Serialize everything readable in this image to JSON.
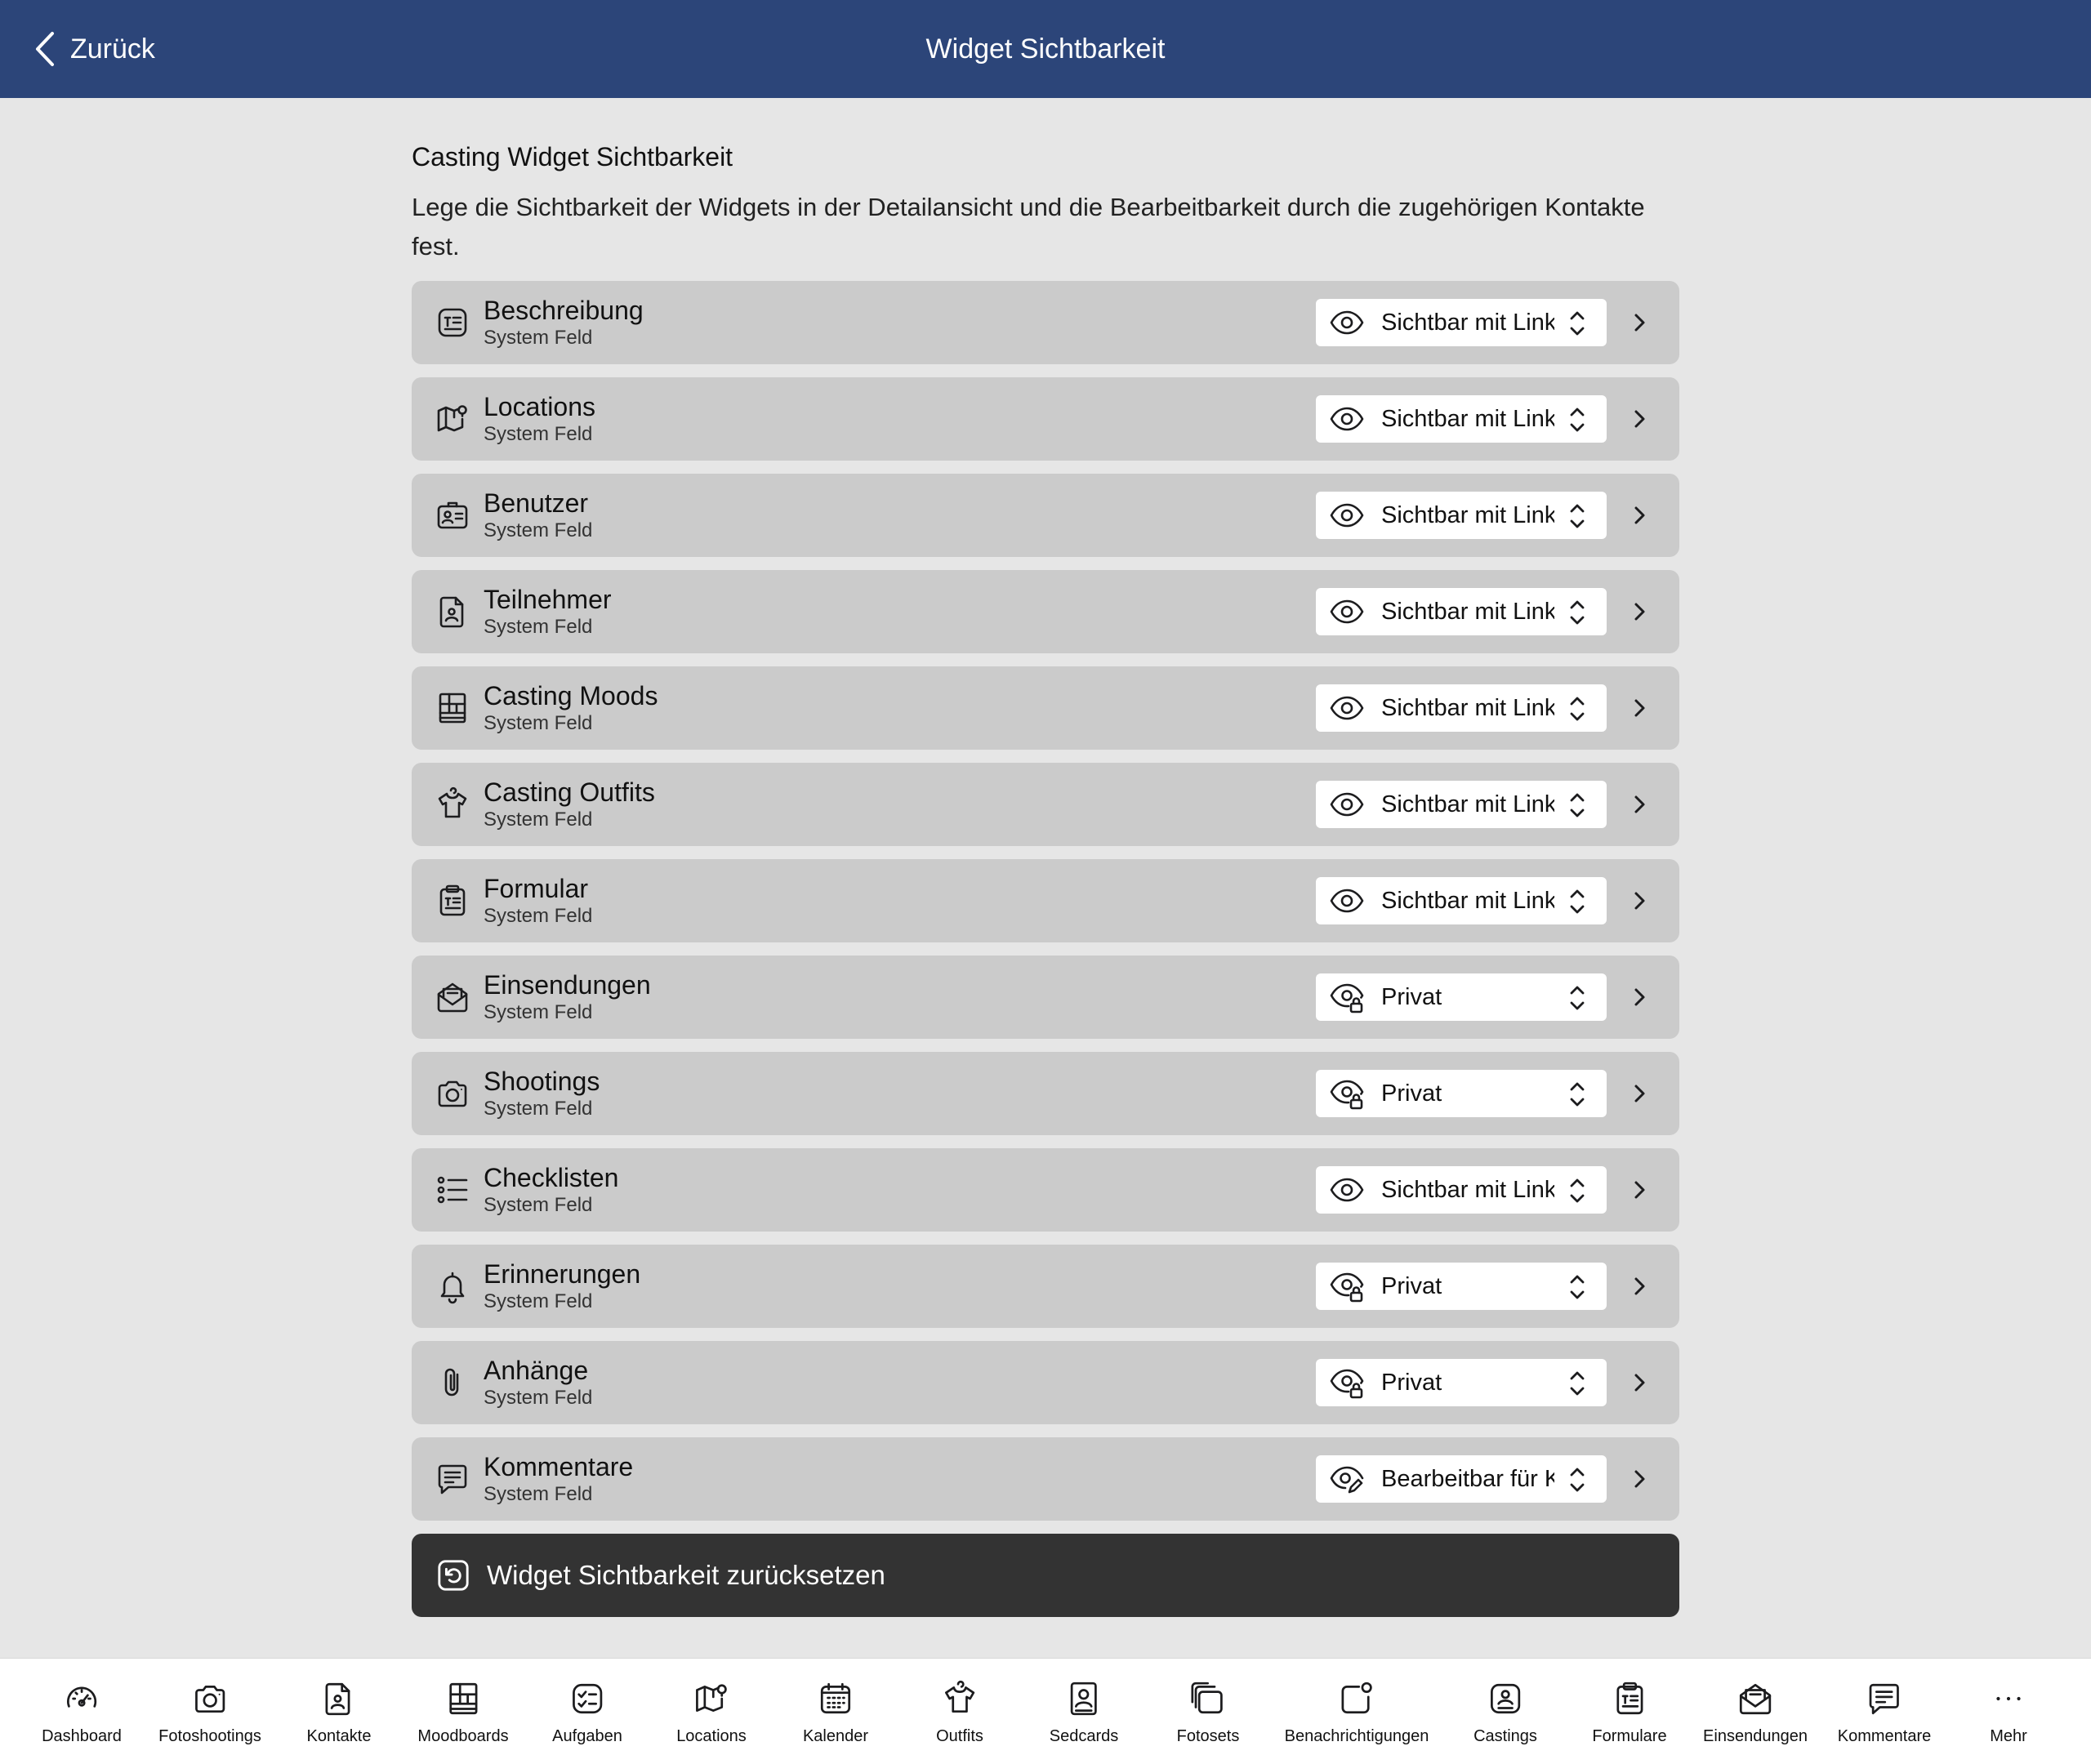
{
  "header": {
    "back_label": "Zurück",
    "title": "Widget Sichtbarkeit"
  },
  "intro": {
    "title": "Casting Widget Sichtbarkeit",
    "description": "Lege die Sichtbarkeit der Widgets in der Detailansicht und die Bearbeitbarkeit durch die zugehörigen Kontakte fest."
  },
  "widgets": [
    {
      "name": "Beschreibung",
      "sub": "System Feld",
      "icon": "text-box-icon",
      "visibility": "Sichtbar mit Link",
      "visibility_icon": "eye-icon"
    },
    {
      "name": "Locations",
      "sub": "System Feld",
      "icon": "map-pin-icon",
      "visibility": "Sichtbar mit Link",
      "visibility_icon": "eye-icon"
    },
    {
      "name": "Benutzer",
      "sub": "System Feld",
      "icon": "id-card-icon",
      "visibility": "Sichtbar mit Link",
      "visibility_icon": "eye-icon"
    },
    {
      "name": "Teilnehmer",
      "sub": "System Feld",
      "icon": "contact-file-icon",
      "visibility": "Sichtbar mit Link",
      "visibility_icon": "eye-icon"
    },
    {
      "name": "Casting Moods",
      "sub": "System Feld",
      "icon": "moodboard-icon",
      "visibility": "Sichtbar mit Link",
      "visibility_icon": "eye-icon"
    },
    {
      "name": "Casting Outfits",
      "sub": "System Feld",
      "icon": "shirt-icon",
      "visibility": "Sichtbar mit Link",
      "visibility_icon": "eye-icon"
    },
    {
      "name": "Formular",
      "sub": "System Feld",
      "icon": "clipboard-icon",
      "visibility": "Sichtbar mit Link",
      "visibility_icon": "eye-icon"
    },
    {
      "name": "Einsendungen",
      "sub": "System Feld",
      "icon": "envelope-icon",
      "visibility": "Privat",
      "visibility_icon": "eye-lock-icon"
    },
    {
      "name": "Shootings",
      "sub": "System Feld",
      "icon": "camera-icon",
      "visibility": "Privat",
      "visibility_icon": "eye-lock-icon"
    },
    {
      "name": "Checklisten",
      "sub": "System Feld",
      "icon": "checklist-icon",
      "visibility": "Sichtbar mit Link",
      "visibility_icon": "eye-icon"
    },
    {
      "name": "Erinnerungen",
      "sub": "System Feld",
      "icon": "bell-icon",
      "visibility": "Privat",
      "visibility_icon": "eye-lock-icon"
    },
    {
      "name": "Anhänge",
      "sub": "System Feld",
      "icon": "paperclip-icon",
      "visibility": "Privat",
      "visibility_icon": "eye-lock-icon"
    },
    {
      "name": "Kommentare",
      "sub": "System Feld",
      "icon": "comment-icon",
      "visibility": "Bearbeitbar für K",
      "visibility_icon": "eye-edit-icon"
    }
  ],
  "reset": {
    "label": "Widget Sichtbarkeit zurücksetzen",
    "icon": "reset-icon"
  },
  "tabbar": [
    {
      "label": "Dashboard",
      "icon": "gauge-icon"
    },
    {
      "label": "Fotoshootings",
      "icon": "camera-icon"
    },
    {
      "label": "Kontakte",
      "icon": "contact-file-icon"
    },
    {
      "label": "Moodboards",
      "icon": "moodboard-icon"
    },
    {
      "label": "Aufgaben",
      "icon": "task-icon"
    },
    {
      "label": "Locations",
      "icon": "map-pin-icon"
    },
    {
      "label": "Kalender",
      "icon": "calendar-icon"
    },
    {
      "label": "Outfits",
      "icon": "shirt-icon"
    },
    {
      "label": "Sedcards",
      "icon": "sedcard-icon"
    },
    {
      "label": "Fotosets",
      "icon": "photo-stack-icon"
    },
    {
      "label": "Benachrichtigungen",
      "icon": "notification-icon"
    },
    {
      "label": "Castings",
      "icon": "casting-icon"
    },
    {
      "label": "Formulare",
      "icon": "clipboard-icon"
    },
    {
      "label": "Einsendungen",
      "icon": "envelope-icon"
    },
    {
      "label": "Kommentare",
      "icon": "comment-icon"
    },
    {
      "label": "Mehr",
      "icon": "more-icon"
    }
  ]
}
